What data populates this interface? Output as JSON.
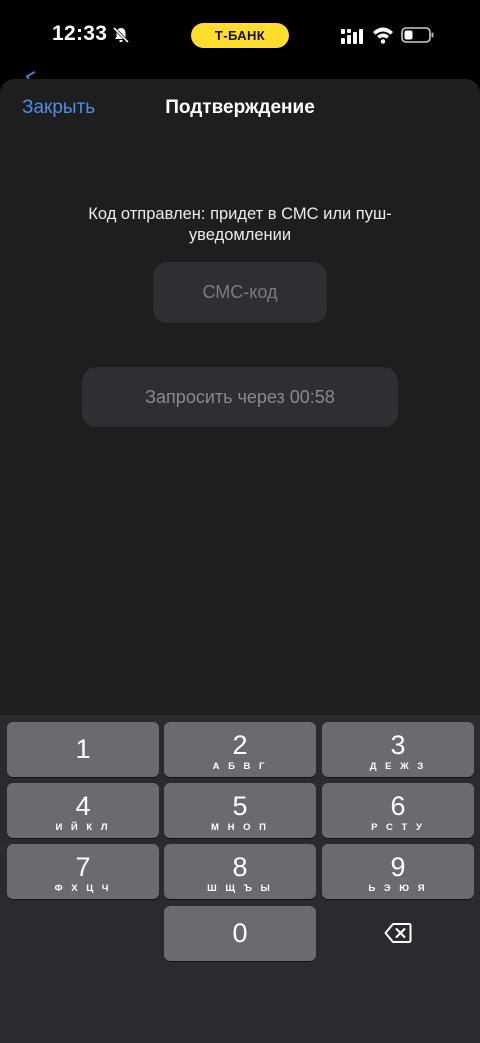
{
  "status_bar": {
    "time": "12:33",
    "carrier_pill": "Т-БАНК",
    "icons": [
      "bell-slash-icon",
      "signal-icon",
      "wifi-icon",
      "battery-icon"
    ]
  },
  "header": {
    "close_label": "Закрыть",
    "title": "Подтверждение"
  },
  "main": {
    "message": "Код отправлен: придет в СМС или пуш-уведомлении",
    "code_placeholder": "СМС-код",
    "resend_label": "Запросить через 00:58"
  },
  "keypad": {
    "keys": [
      {
        "digit": "1",
        "letters": ""
      },
      {
        "digit": "2",
        "letters": "А Б В Г"
      },
      {
        "digit": "3",
        "letters": "Д Е Ж З"
      },
      {
        "digit": "4",
        "letters": "И Й К Л"
      },
      {
        "digit": "5",
        "letters": "М Н О П"
      },
      {
        "digit": "6",
        "letters": "Р С Т У"
      },
      {
        "digit": "7",
        "letters": "Ф Х Ц Ч"
      },
      {
        "digit": "8",
        "letters": "Ш Щ Ъ Ы"
      },
      {
        "digit": "9",
        "letters": "Ь Э Ю Я"
      },
      {
        "digit": "0",
        "letters": ""
      }
    ],
    "delete_icon": "backspace-icon"
  },
  "colors": {
    "accent": "#4d8ee8",
    "pill": "#ffdd2d",
    "sheet": "#1e1e1f",
    "key": "#6b6b6e"
  }
}
